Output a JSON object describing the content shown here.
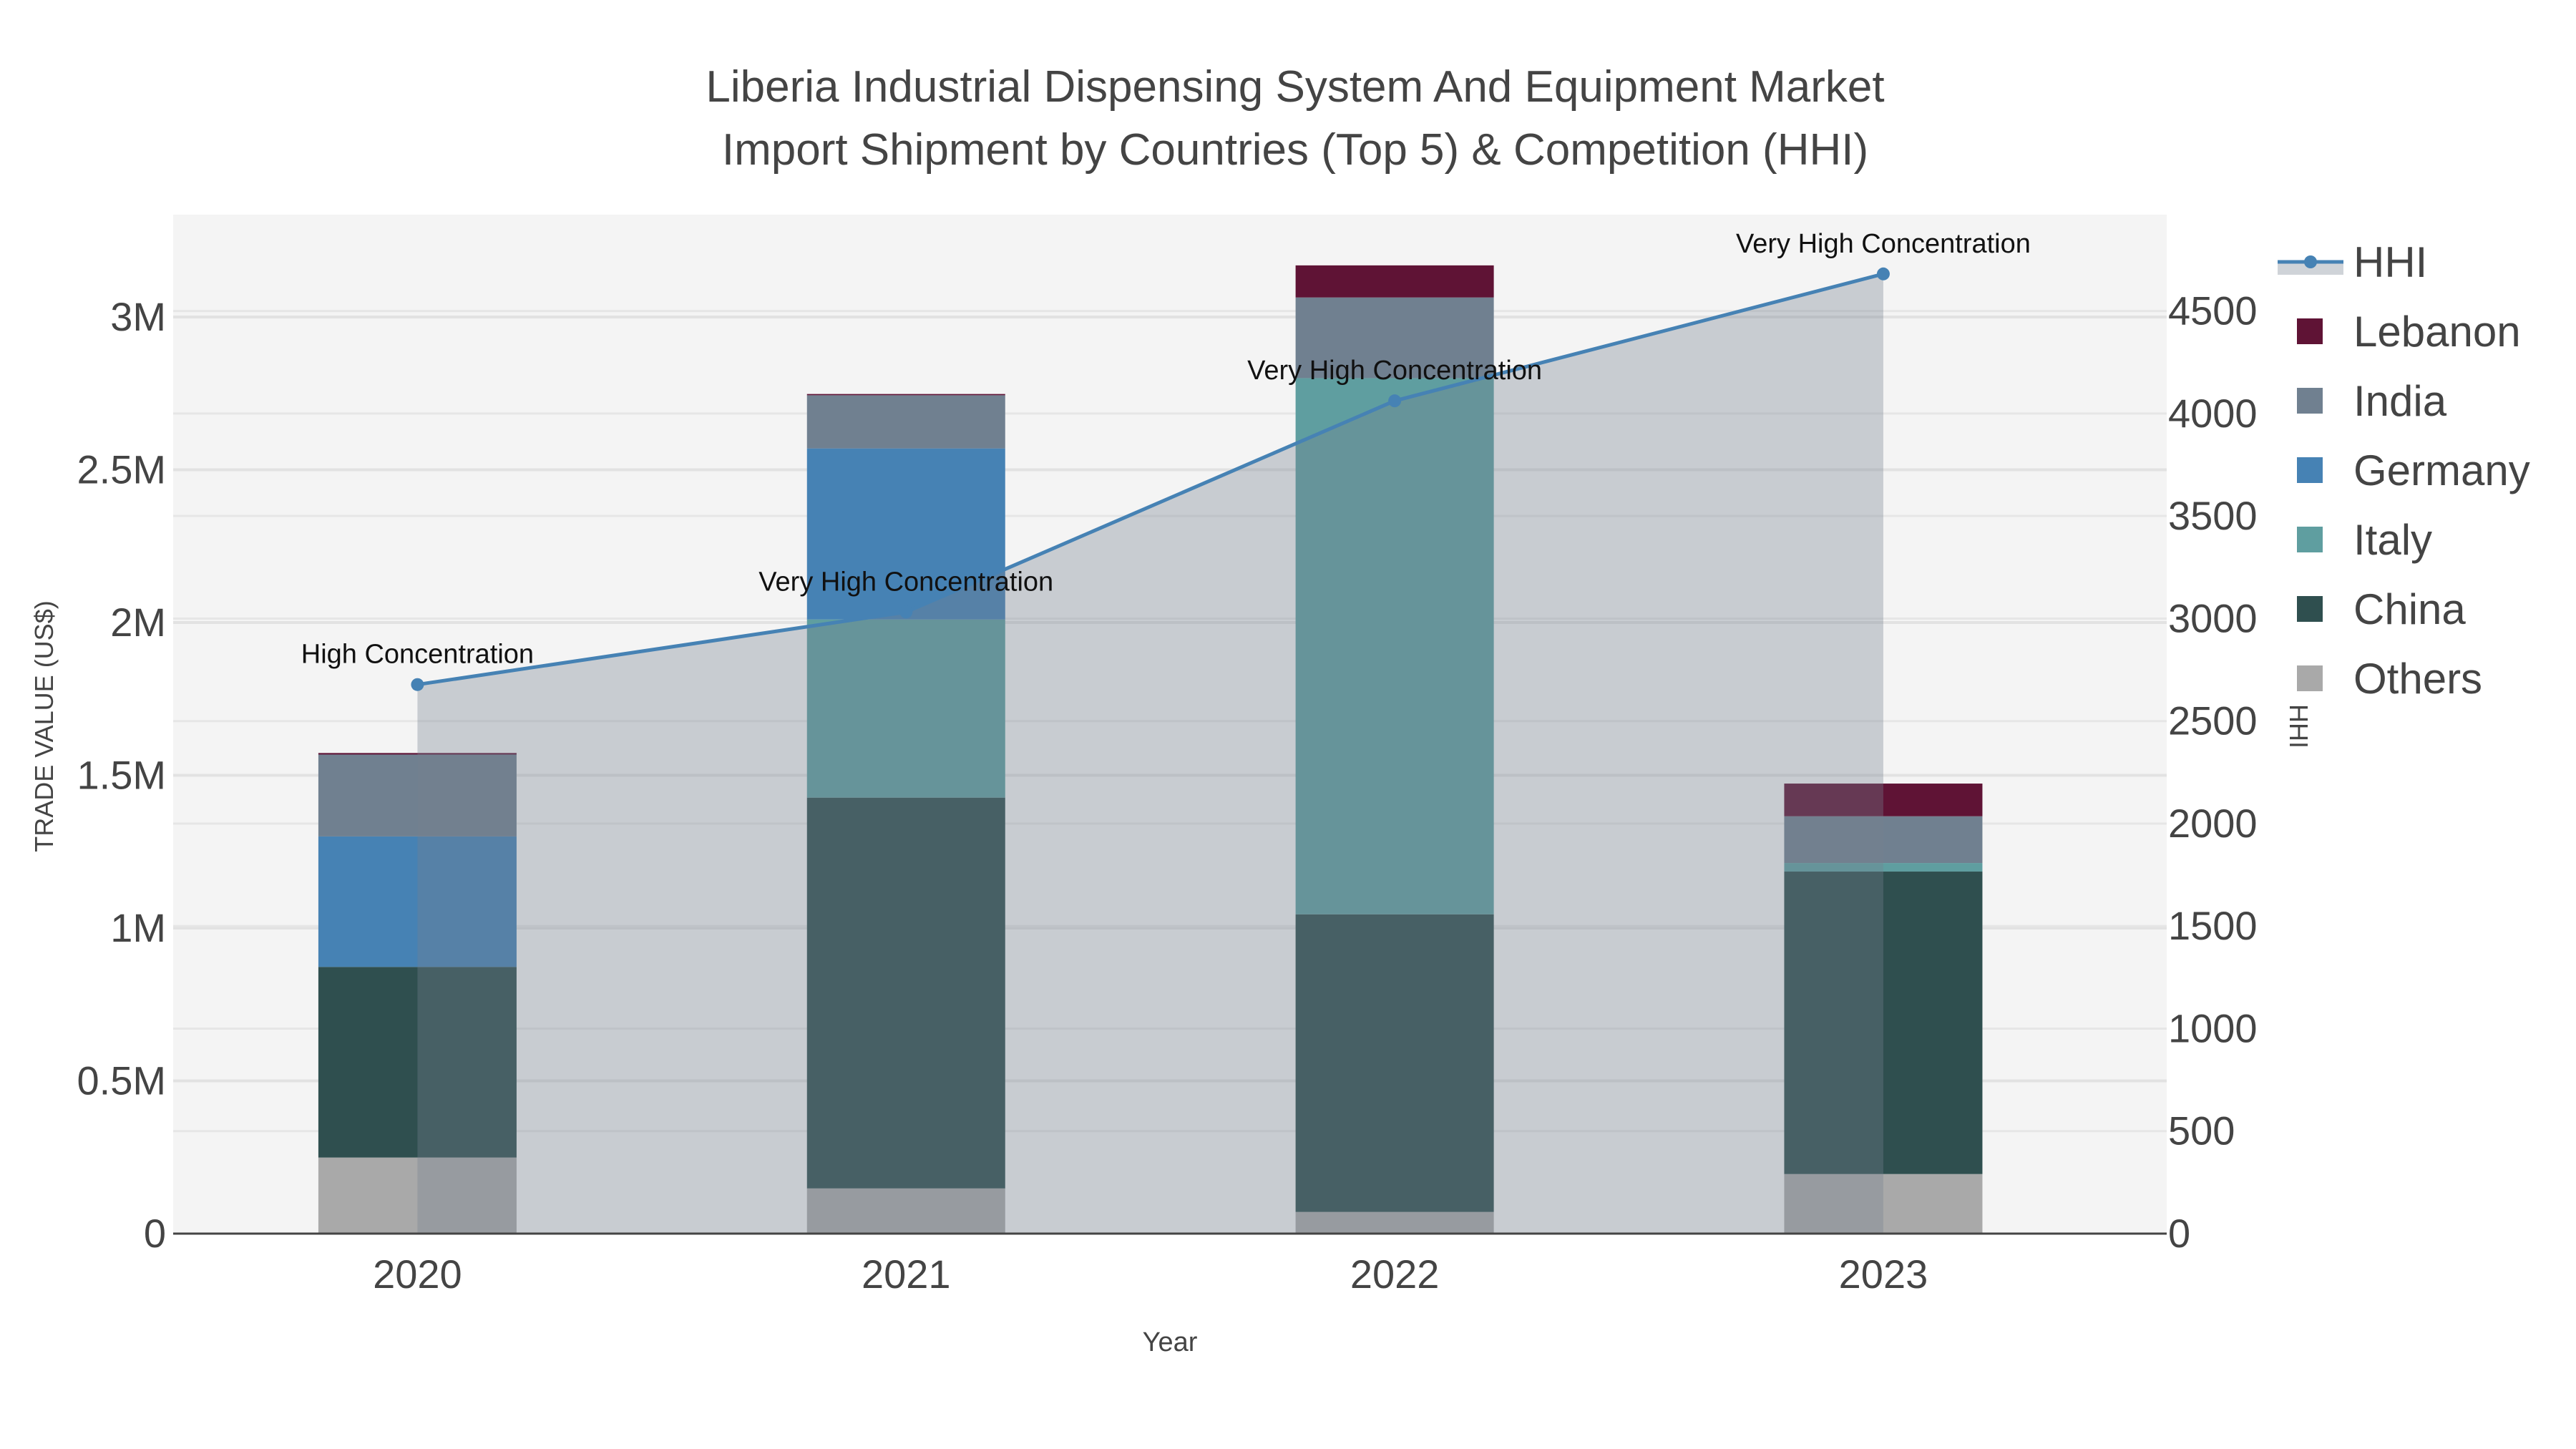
{
  "chart_data": {
    "type": "bar",
    "stacked": true,
    "title_line1": "Liberia Industrial Dispensing System And Equipment Market",
    "title_line2": "Import Shipment by Countries (Top 5) & Competition (HHI)",
    "xlabel": "Year",
    "ylabel": "TRADE VALUE (US$)",
    "y2label": "HHI",
    "categories": [
      "2020",
      "2021",
      "2022",
      "2023"
    ],
    "ylim": [
      0,
      3335000
    ],
    "y2lim": [
      0,
      4970
    ],
    "yticks": [
      {
        "v": 0,
        "label": "0"
      },
      {
        "v": 500000,
        "label": "0.5M"
      },
      {
        "v": 1000000,
        "label": "1M"
      },
      {
        "v": 1500000,
        "label": "1.5M"
      },
      {
        "v": 2000000,
        "label": "2M"
      },
      {
        "v": 2500000,
        "label": "2.5M"
      },
      {
        "v": 3000000,
        "label": "3M"
      }
    ],
    "y2ticks": [
      {
        "v": 0,
        "label": "0"
      },
      {
        "v": 500,
        "label": "500"
      },
      {
        "v": 1000,
        "label": "1000"
      },
      {
        "v": 1500,
        "label": "1500"
      },
      {
        "v": 2000,
        "label": "2000"
      },
      {
        "v": 2500,
        "label": "2500"
      },
      {
        "v": 3000,
        "label": "3000"
      },
      {
        "v": 3500,
        "label": "3500"
      },
      {
        "v": 4000,
        "label": "4000"
      },
      {
        "v": 4500,
        "label": "4500"
      }
    ],
    "grid": true,
    "legend_position": "right",
    "series": [
      {
        "name": "Others",
        "color": "#a9a9a9",
        "values": [
          249000,
          148000,
          71000,
          195000
        ]
      },
      {
        "name": "China",
        "color": "#2f4f4f",
        "values": [
          624000,
          1279000,
          974000,
          990000
        ]
      },
      {
        "name": "Italy",
        "color": "#5f9ea0",
        "values": [
          0,
          583000,
          1755000,
          28000
        ]
      },
      {
        "name": "Germany",
        "color": "#4682b4",
        "values": [
          427000,
          560000,
          0,
          0
        ]
      },
      {
        "name": "India",
        "color": "#708090",
        "values": [
          268000,
          174000,
          264000,
          153000
        ]
      },
      {
        "name": "Lebanon",
        "color": "#5f1335",
        "values": [
          5000,
          4000,
          105000,
          107000
        ]
      }
    ],
    "hhi": {
      "name": "HHI",
      "color": "#4682b4",
      "values": [
        2678,
        3032,
        4062,
        4681
      ],
      "annotations": [
        "High Concentration",
        "Very High Concentration",
        "Very High Concentration",
        "Very High Concentration"
      ]
    },
    "legend_order": [
      "HHI",
      "Lebanon",
      "India",
      "Germany",
      "Italy",
      "China",
      "Others"
    ]
  }
}
